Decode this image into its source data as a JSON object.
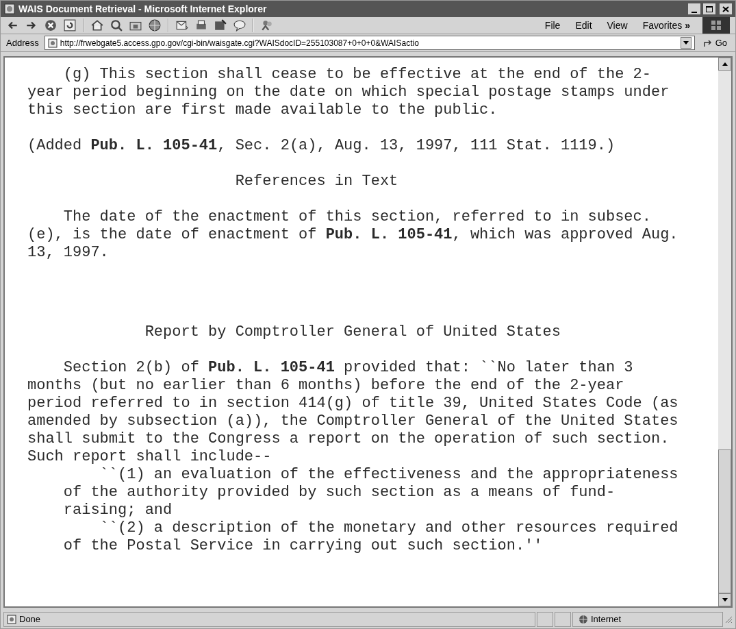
{
  "window": {
    "title": "WAIS Document Retrieval - Microsoft Internet Explorer"
  },
  "menu": [
    "File",
    "Edit",
    "View",
    "Favorites"
  ],
  "menu_overflow": "»",
  "address": {
    "label": "Address",
    "value": "http://frwebgate5.access.gpo.gov/cgi-bin/waisgate.cgi?WAISdocID=255103087+0+0+0&WAISactio",
    "go": "Go"
  },
  "document": {
    "blocks": [
      {
        "kind": "paragraph",
        "text": "    (g) This section shall cease to be effective at the end of the 2-\nyear period beginning on the date on which special postage stamps under\nthis section are first made available to the public."
      },
      {
        "kind": "paragraph",
        "text": "(Added **Pub. L. 105-41**, Sec. 2(a), Aug. 13, 1997, 111 Stat. 1119.)"
      },
      {
        "kind": "heading",
        "text": "                       References in Text"
      },
      {
        "kind": "paragraph",
        "text": "    The date of the enactment of this section, referred to in subsec.\n(e), is the date of enactment of **Pub. L. 105-41**, which was approved Aug.\n13, 1997."
      },
      {
        "kind": "heading",
        "text": "             Report by Comptroller General of United States"
      },
      {
        "kind": "paragraph",
        "text": "    Section 2(b) of **Pub. L. 105-41** provided that: ``No later than 3\nmonths (but no earlier than 6 months) before the end of the 2-year\nperiod referred to in section 414(g) of title 39, United States Code (as\namended by subsection (a)), the Comptroller General of the United States\nshall submit to the Congress a report on the operation of such section.\nSuch report shall include--\n        ``(1) an evaluation of the effectiveness and the appropriateness\n    of the authority provided by such section as a means of fund-\n    raising; and\n        ``(2) a description of the monetary and other resources required\n    of the Postal Service in carrying out such section.''"
      }
    ]
  },
  "status_bar": {
    "text": "Done",
    "zone": "Internet"
  }
}
